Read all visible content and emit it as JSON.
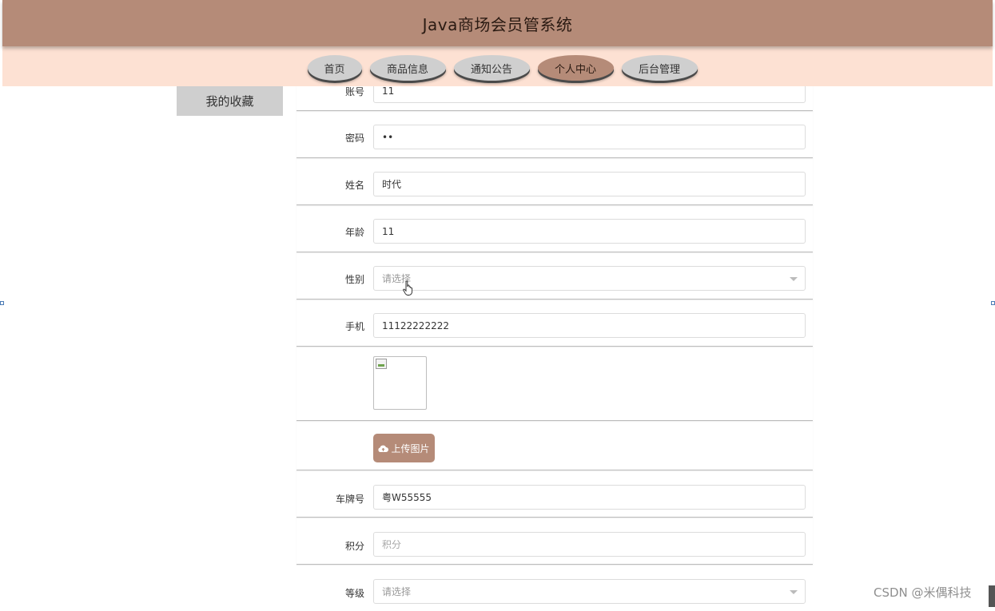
{
  "header": {
    "title": "Java商场会员管系统"
  },
  "nav": {
    "items": [
      {
        "label": "首页",
        "active": false
      },
      {
        "label": "商品信息",
        "active": false
      },
      {
        "label": "通知公告",
        "active": false
      },
      {
        "label": "个人中心",
        "active": true
      },
      {
        "label": "后台管理",
        "active": false
      }
    ]
  },
  "side_menu": {
    "item": "我的收藏"
  },
  "form": {
    "account": {
      "label": "账号",
      "value": "11"
    },
    "password": {
      "label": "密码",
      "value": "11"
    },
    "name": {
      "label": "姓名",
      "value": "时代"
    },
    "age": {
      "label": "年龄",
      "value": "11"
    },
    "gender": {
      "label": "性别",
      "placeholder": "请选择"
    },
    "phone": {
      "label": "手机",
      "value": "11122222222"
    },
    "upload": {
      "label": "上传图片"
    },
    "plate": {
      "label": "车牌号",
      "value": "粤W55555"
    },
    "points": {
      "label": "积分",
      "placeholder": "积分"
    },
    "level": {
      "label": "等级",
      "placeholder": "请选择"
    }
  },
  "watermark": "CSDN @米偶科技",
  "colors": {
    "accent": "#b58b78",
    "nav_bg": "#fde1d3",
    "nav_item": "#cfcfcf"
  }
}
